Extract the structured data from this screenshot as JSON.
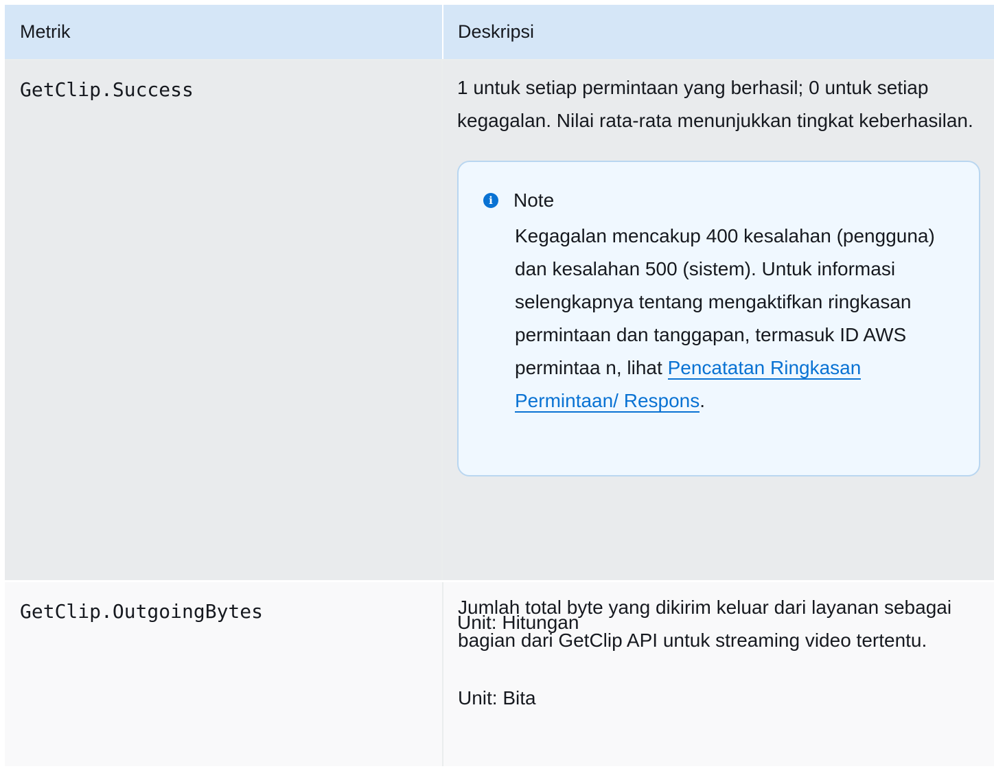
{
  "table": {
    "headers": {
      "metric": "Metrik",
      "description": "Deskripsi"
    },
    "rows": [
      {
        "metric": "GetClip.Success",
        "description": "1 untuk setiap permintaan yang berhasil; 0 untuk setiap kegagalan. Nilai rata-rata menunjukkan tingkat keberhasilan.",
        "note": {
          "icon": "info-icon",
          "title": "Note",
          "body_before": "Kegagalan mencakup 400 kesalahan (pengguna) dan kesalahan 500 (sistem). Untuk informasi selengkapnya tentang mengaktifkan ringkasan permintaan dan tanggapan, termasuk ID AWS permintaa n, lihat ",
          "link": "Pencatatan Ringkasan Permintaan/ Respons",
          "body_after": "."
        },
        "unit": "Unit: Hitungan"
      },
      {
        "metric": "GetClip.OutgoingBytes",
        "description": "Jumlah total byte yang dikirim keluar dari layanan sebagai bagian dari GetClip API untuk streaming video tertentu.",
        "unit": "Unit: Bita"
      }
    ]
  }
}
